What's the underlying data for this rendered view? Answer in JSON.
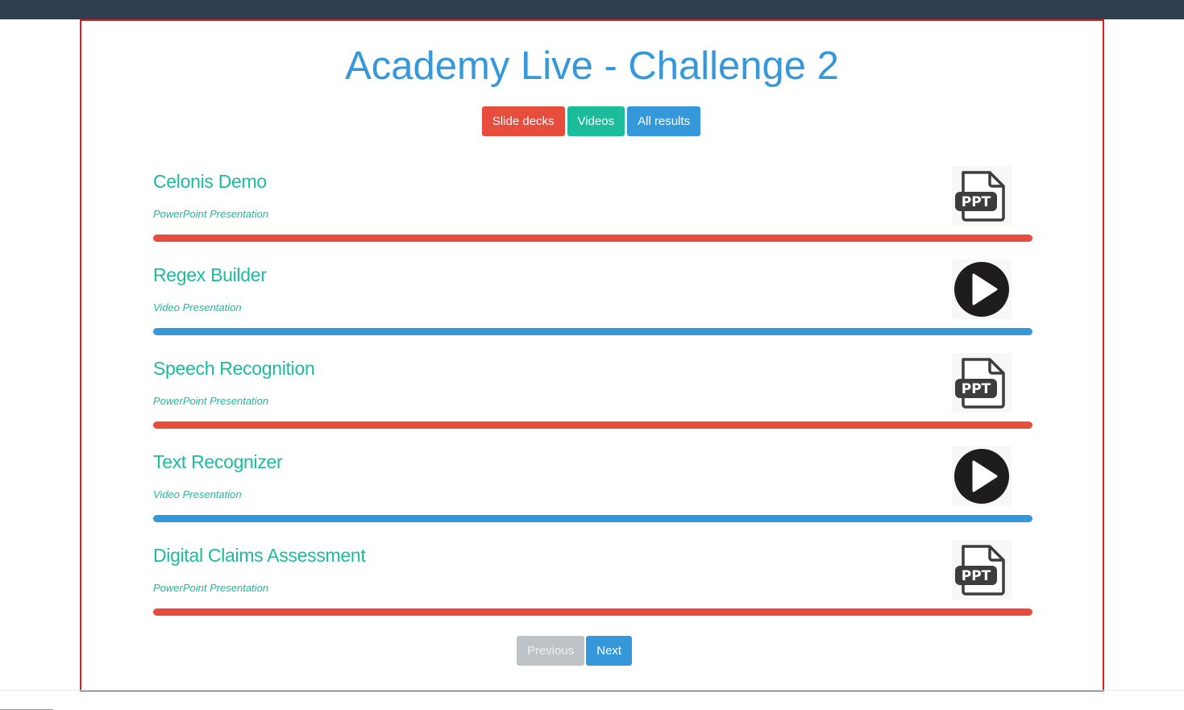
{
  "page": {
    "title": "Academy Live - Challenge 2"
  },
  "filters": {
    "slide_decks": "Slide decks",
    "videos": "Videos",
    "all_results": "All results"
  },
  "items": [
    {
      "title": "Celonis Demo",
      "type": "PowerPoint Presentation",
      "icon": "ppt-file-icon",
      "icon_label": "PPT",
      "bar_color": "#e74c3c"
    },
    {
      "title": "Regex Builder",
      "type": "Video Presentation",
      "icon": "play-icon",
      "bar_color": "#3498db"
    },
    {
      "title": "Speech Recognition",
      "type": "PowerPoint Presentation",
      "icon": "ppt-file-icon",
      "icon_label": "PPT",
      "bar_color": "#e74c3c"
    },
    {
      "title": "Text Recognizer",
      "type": "Video Presentation",
      "icon": "play-icon",
      "bar_color": "#3498db"
    },
    {
      "title": "Digital Claims Assessment",
      "type": "PowerPoint Presentation",
      "icon": "ppt-file-icon",
      "icon_label": "PPT",
      "bar_color": "#e74c3c"
    }
  ],
  "pager": {
    "previous": "Previous",
    "next": "Next"
  },
  "colors": {
    "topbar": "#2c3e50",
    "frame_border": "#e31b1b",
    "title": "#3498db",
    "accent_green": "#1abc9c",
    "accent_red": "#e74c3c",
    "accent_blue": "#3498db",
    "disabled_gray": "#bdc3c7"
  }
}
